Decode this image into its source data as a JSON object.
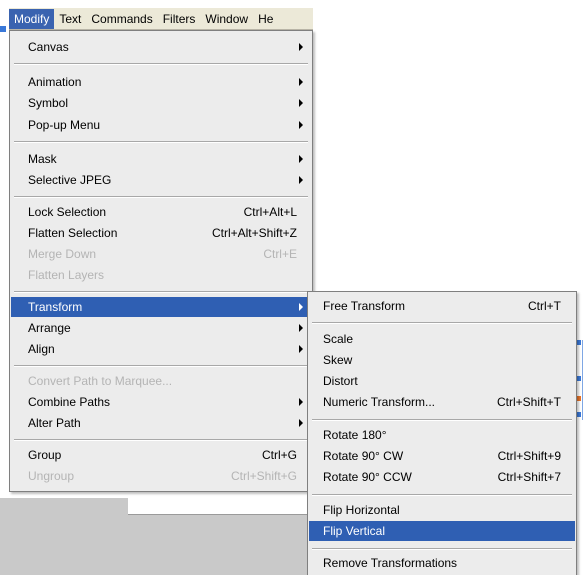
{
  "menubar": {
    "items": [
      {
        "label": "Modify"
      },
      {
        "label": "Text"
      },
      {
        "label": "Commands"
      },
      {
        "label": "Filters"
      },
      {
        "label": "Window"
      },
      {
        "label": "He"
      }
    ]
  },
  "modify_menu": {
    "items": [
      {
        "label": "Canvas",
        "shortcut": ""
      },
      {
        "label": "Animation",
        "shortcut": ""
      },
      {
        "label": "Symbol",
        "shortcut": ""
      },
      {
        "label": "Pop-up Menu",
        "shortcut": ""
      },
      {
        "label": "Mask",
        "shortcut": ""
      },
      {
        "label": "Selective JPEG",
        "shortcut": ""
      },
      {
        "label": "Lock Selection",
        "shortcut": "Ctrl+Alt+L"
      },
      {
        "label": "Flatten Selection",
        "shortcut": "Ctrl+Alt+Shift+Z"
      },
      {
        "label": "Merge Down",
        "shortcut": "Ctrl+E"
      },
      {
        "label": "Flatten Layers",
        "shortcut": ""
      },
      {
        "label": "Transform",
        "shortcut": ""
      },
      {
        "label": "Arrange",
        "shortcut": ""
      },
      {
        "label": "Align",
        "shortcut": ""
      },
      {
        "label": "Convert Path to Marquee...",
        "shortcut": ""
      },
      {
        "label": "Combine Paths",
        "shortcut": ""
      },
      {
        "label": "Alter Path",
        "shortcut": ""
      },
      {
        "label": "Group",
        "shortcut": "Ctrl+G"
      },
      {
        "label": "Ungroup",
        "shortcut": "Ctrl+Shift+G"
      }
    ]
  },
  "transform_menu": {
    "items": [
      {
        "label": "Free Transform",
        "shortcut": "Ctrl+T"
      },
      {
        "label": "Scale",
        "shortcut": ""
      },
      {
        "label": "Skew",
        "shortcut": ""
      },
      {
        "label": "Distort",
        "shortcut": ""
      },
      {
        "label": "Numeric Transform...",
        "shortcut": "Ctrl+Shift+T"
      },
      {
        "label": "Rotate 180°",
        "shortcut": ""
      },
      {
        "label": "Rotate 90° CW",
        "shortcut": "Ctrl+Shift+9"
      },
      {
        "label": "Rotate 90° CCW",
        "shortcut": "Ctrl+Shift+7"
      },
      {
        "label": "Flip Horizontal",
        "shortcut": ""
      },
      {
        "label": "Flip Vertical",
        "shortcut": ""
      },
      {
        "label": "Remove Transformations",
        "shortcut": ""
      }
    ]
  },
  "colors": {
    "highlight": "#2f5fb3",
    "menu_bg": "#ececec",
    "disabled_text": "#b4b4b4"
  }
}
